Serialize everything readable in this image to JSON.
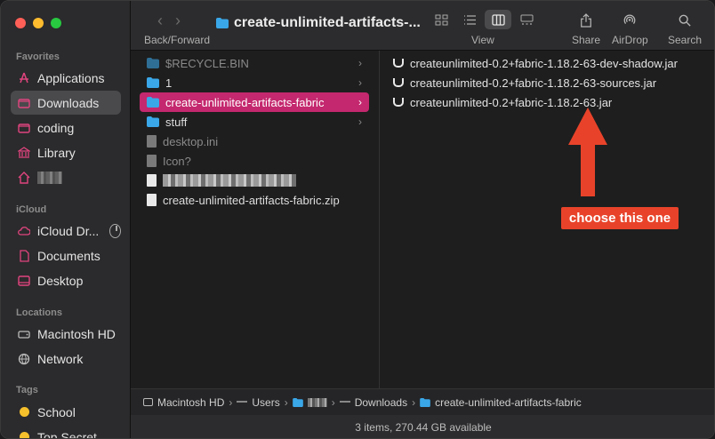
{
  "window": {
    "title": "create-unlimited-artifacts-..."
  },
  "toolbar": {
    "back_forward_label": "Back/Forward",
    "view_label": "View",
    "share_label": "Share",
    "airdrop_label": "AirDrop",
    "search_label": "Search"
  },
  "sidebar": {
    "favorites_title": "Favorites",
    "favorites": [
      {
        "label": "Applications",
        "icon": "applications-icon"
      },
      {
        "label": "Downloads",
        "icon": "downloads-icon",
        "selected": true
      },
      {
        "label": "coding",
        "icon": "folder-icon"
      },
      {
        "label": "Library",
        "icon": "library-icon"
      },
      {
        "label": "",
        "icon": "home-icon"
      }
    ],
    "icloud_title": "iCloud",
    "icloud": [
      {
        "label": "iCloud Dr...",
        "icon": "icloud-icon"
      },
      {
        "label": "Documents",
        "icon": "document-icon"
      },
      {
        "label": "Desktop",
        "icon": "desktop-icon"
      }
    ],
    "locations_title": "Locations",
    "locations": [
      {
        "label": "Macintosh HD",
        "icon": "disk-icon"
      },
      {
        "label": "Network",
        "icon": "network-icon"
      }
    ],
    "tags_title": "Tags",
    "tags": [
      {
        "label": "School",
        "color": "#f5c02c"
      },
      {
        "label": "Top Secret",
        "color": "#f5c02c"
      }
    ]
  },
  "column1": [
    {
      "name": "$RECYCLE.BIN",
      "type": "folder",
      "dim": true,
      "chevron": true
    },
    {
      "name": "1",
      "type": "folder",
      "chevron": true
    },
    {
      "name": "create-unlimited-artifacts-fabric",
      "type": "folder",
      "selected": true,
      "chevron": true
    },
    {
      "name": "stuff",
      "type": "folder",
      "chevron": true
    },
    {
      "name": "desktop.ini",
      "type": "file",
      "dim": true
    },
    {
      "name": "Icon?",
      "type": "file",
      "dim": true
    },
    {
      "name": "",
      "type": "file"
    },
    {
      "name": "create-unlimited-artifacts-fabric.zip",
      "type": "file"
    }
  ],
  "column2": [
    {
      "name": "createunlimited-0.2+fabric-1.18.2-63-dev-shadow.jar"
    },
    {
      "name": "createunlimited-0.2+fabric-1.18.2-63-sources.jar"
    },
    {
      "name": "createunlimited-0.2+fabric-1.18.2-63.jar"
    }
  ],
  "annotation": {
    "text": "choose this one",
    "color": "#e8432a"
  },
  "pathbar": {
    "disk": "Macintosh HD",
    "users": "Users",
    "downloads": "Downloads",
    "folder": "create-unlimited-artifacts-fabric"
  },
  "status": {
    "text": "3 items, 270.44 GB available"
  },
  "colors": {
    "accent": "#c4286e",
    "sidebar_bg": "#2b2a2c"
  }
}
